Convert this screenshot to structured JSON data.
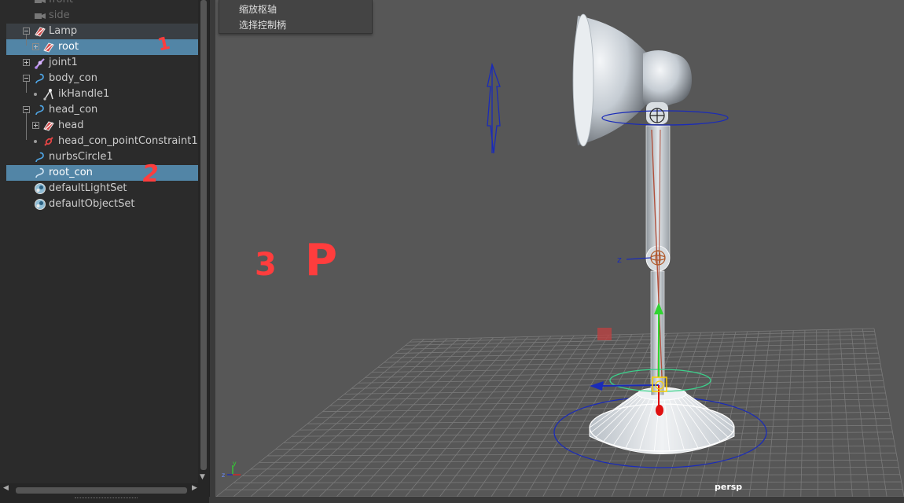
{
  "outliner": {
    "items": [
      {
        "label": "front",
        "icon": "camera-icon"
      },
      {
        "label": "side",
        "icon": "camera-icon"
      },
      {
        "label": "Lamp",
        "icon": "transform-icon"
      },
      {
        "label": "root",
        "icon": "transform-icon"
      },
      {
        "label": "joint1",
        "icon": "joint-icon"
      },
      {
        "label": "body_con",
        "icon": "nurbs-curve-icon"
      },
      {
        "label": "ikHandle1",
        "icon": "ik-handle-icon"
      },
      {
        "label": "head_con",
        "icon": "nurbs-curve-icon"
      },
      {
        "label": "head",
        "icon": "transform-icon"
      },
      {
        "label": "head_con_pointConstraint1",
        "icon": "constraint-icon"
      },
      {
        "label": "nurbsCircle1",
        "icon": "nurbs-curve-icon"
      },
      {
        "label": "root_con",
        "icon": "nurbs-curve-icon"
      },
      {
        "label": "defaultLightSet",
        "icon": "set-icon"
      },
      {
        "label": "defaultObjectSet",
        "icon": "set-icon"
      }
    ],
    "selected": [
      "root",
      "root_con"
    ]
  },
  "annotations": {
    "mark_1": "1",
    "mark_2": "2",
    "mark_3": "3",
    "mark_p": "P"
  },
  "context_menu": {
    "items": [
      "缩放枢轴",
      "选择控制柄"
    ]
  },
  "viewport": {
    "camera_label": "persp",
    "manipulator_axis_label": "z",
    "axis_gizmo": {
      "y": "y",
      "z": "z"
    }
  },
  "colors": {
    "selection": "#5285a6",
    "annotation": "#ff3d3d",
    "viewport_bg": "#575757",
    "nurbs_control": "#1a2bb8",
    "grid": "#7a7a7a"
  }
}
